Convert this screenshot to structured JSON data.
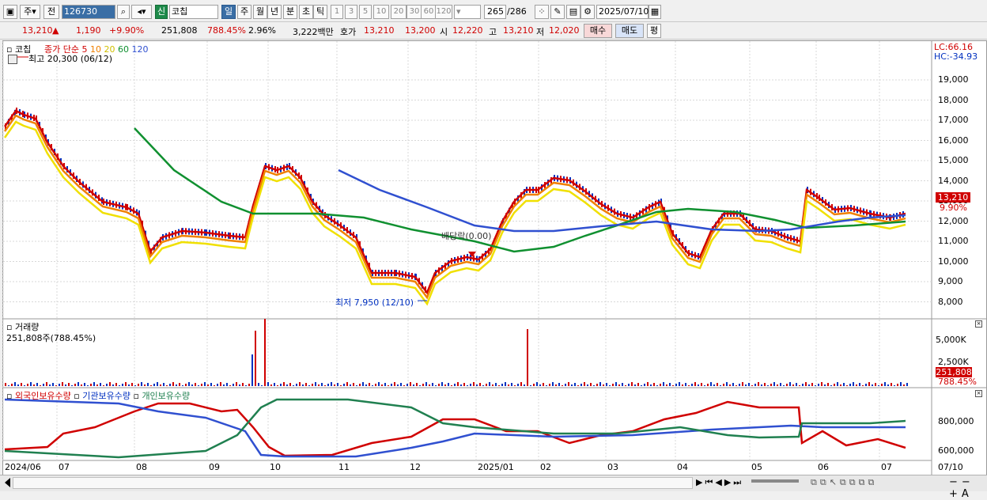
{
  "toolbar": {
    "market_btn": "주",
    "mode_btn": "전",
    "code": "126730",
    "new_badge": "신",
    "stock_name": "코칩",
    "periods": [
      "일",
      "주",
      "월",
      "년",
      "분",
      "초",
      "틱"
    ],
    "numbers": [
      "1",
      "3",
      "5",
      "10",
      "20",
      "30",
      "60",
      "120"
    ],
    "count": "265",
    "total": "/286",
    "date": "2025/07/10"
  },
  "quote": {
    "price": "13,210",
    "arrow": "▲",
    "change": "1,190",
    "rate": "+9.90%",
    "volume": "251,808",
    "vol_rate": "788.45%",
    "turnover": "2.96%",
    "amount": "3,222백만",
    "ask_label": "호가",
    "ask": "13,210",
    "bid": "13,200",
    "open_label": "시",
    "open": "12,220",
    "high_label": "고",
    "high": "13,210",
    "low_label": "저",
    "low": "12,020",
    "buy_btn": "매수",
    "sell_btn": "매도",
    "eval_btn": "평"
  },
  "price_panel": {
    "stock": "코칩",
    "ma_title": "종가 단순",
    "ma": [
      "5",
      "10",
      "20",
      "60",
      "120"
    ],
    "ma_colors": [
      "#d00000",
      "#f08000",
      "#f0e000",
      "#109030",
      "#3050d0"
    ],
    "high_note": "최고 20,300 (06/12)",
    "low_note": "최저 7,950 (12/10)",
    "div_note": "배당락(0.00)",
    "lc": "LC:66.16",
    "hc": "HC:-34.93",
    "y_ticks": [
      "19,000",
      "18,000",
      "17,000",
      "16,000",
      "15,000",
      "14,000",
      "13,000",
      "12,000",
      "11,000",
      "10,000",
      "9,000",
      "8,000"
    ],
    "cur_price": "13,210",
    "cur_rate": "9.90%"
  },
  "volume_panel": {
    "title": "거래량",
    "info": "251,808주(788.45%)",
    "y_ticks": [
      "5,000K",
      "2,500K"
    ],
    "cur": "251,808",
    "cur_rate": "788.45%"
  },
  "holding_panel": {
    "series": [
      "외국인보유수량",
      "기관보유수량",
      "개인보유수량"
    ],
    "colors": [
      "#d00000",
      "#3050d0",
      "#208050"
    ],
    "y_ticks": [
      "800,000",
      "600,000"
    ]
  },
  "x_ticks": [
    "2024/06",
    "07",
    "08",
    "09",
    "10",
    "11",
    "12",
    "2025/01",
    "02",
    "03",
    "04",
    "05",
    "06",
    "07",
    "07/10"
  ]
}
